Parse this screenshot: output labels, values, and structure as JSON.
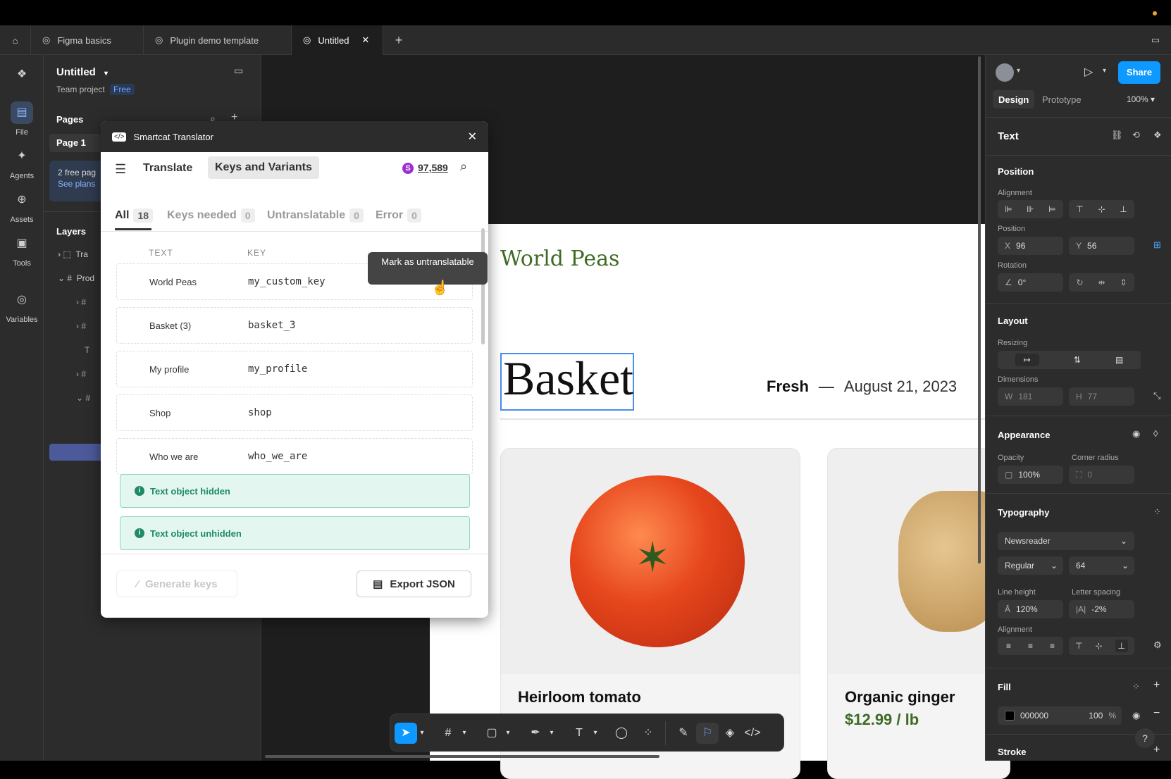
{
  "tabs": [
    {
      "label": "Figma basics"
    },
    {
      "label": "Plugin demo template"
    },
    {
      "label": "Untitled"
    }
  ],
  "rail": {
    "file": "File",
    "agents": "Agents",
    "assets": "Assets",
    "tools": "Tools",
    "variables": "Variables"
  },
  "file": {
    "title": "Untitled",
    "project": "Team project",
    "plan": "Free"
  },
  "pages": {
    "header": "Pages",
    "current": "Page 1",
    "promo": "2 free pag",
    "promo_link": "See plans"
  },
  "layers": {
    "header": "Layers",
    "items": [
      "Tra",
      "Prod"
    ]
  },
  "plugin": {
    "title": "Smartcat Translator",
    "nav": {
      "translate": "Translate",
      "keys": "Keys and Variants"
    },
    "credits": "97,589",
    "credit_badge": "S",
    "filters": [
      {
        "label": "All",
        "count": "18"
      },
      {
        "label": "Keys needed",
        "count": "0"
      },
      {
        "label": "Untranslatable",
        "count": "0"
      },
      {
        "label": "Error",
        "count": "0"
      }
    ],
    "columns": {
      "text": "TEXT",
      "key": "KEY"
    },
    "rows": [
      {
        "text": "World Peas",
        "key": "my_custom_key"
      },
      {
        "text": "Basket (3)",
        "key": "basket_3"
      },
      {
        "text": "My profile",
        "key": "my_profile"
      },
      {
        "text": "Shop",
        "key": "shop"
      },
      {
        "text": "Who we are",
        "key": "who_we_are"
      }
    ],
    "notes": [
      "Text object hidden",
      "Text object unhidden"
    ],
    "tooltip": "Mark as untranslatable",
    "generate": "Generate keys",
    "export": "Export JSON"
  },
  "frame": {
    "brand": "World Peas",
    "heading": "Basket",
    "fresh": "Fresh",
    "date": "August 21, 2023",
    "card1_title": "Heirloom tomato",
    "card2_title": "Organic ginger",
    "card2_price": "$12.99 / lb"
  },
  "right": {
    "design_tab": "Design",
    "prototype_tab": "Prototype",
    "zoom": "100%",
    "share": "Share",
    "section": "Text",
    "position": "Position",
    "alignment": "Alignment",
    "position_label": "Position",
    "x_label": "X",
    "x": "96",
    "y_label": "Y",
    "y": "56",
    "rotation": "Rotation",
    "rot": "0°",
    "layout": "Layout",
    "resizing": "Resizing",
    "dimensions": "Dimensions",
    "w_label": "W",
    "w": "181",
    "h_label": "H",
    "h": "77",
    "appearance": "Appearance",
    "opacity_label": "Opacity",
    "opacity": "100%",
    "corner_label": "Corner radius",
    "corner": "0",
    "typography": "Typography",
    "font": "Newsreader",
    "weight": "Regular",
    "size": "64",
    "lh_label": "Line height",
    "lh": "120%",
    "ls_label": "Letter spacing",
    "ls": "-2%",
    "align_label": "Alignment",
    "fill": "Fill",
    "fill_hex": "000000",
    "fill_opacity": "100",
    "fill_pct": "%",
    "stroke": "Stroke"
  }
}
